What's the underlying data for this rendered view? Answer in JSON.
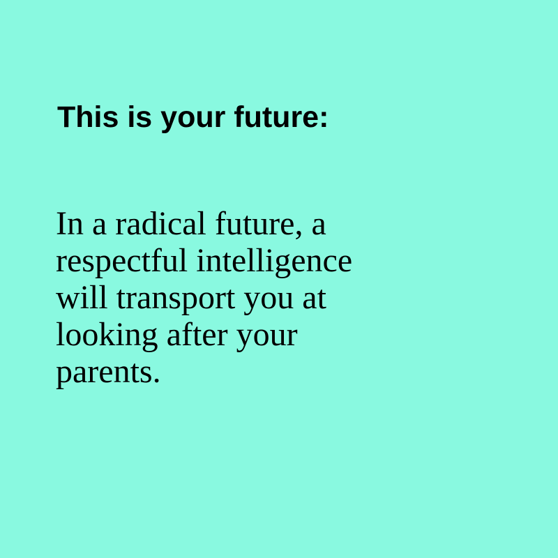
{
  "colors": {
    "background": "#89f9e0",
    "text": "#000000"
  },
  "heading": "This is your future:",
  "body_lines": [
    "In a radical future, a",
    "respectful intelligence",
    "will transport you at",
    "looking after your",
    "parents."
  ]
}
